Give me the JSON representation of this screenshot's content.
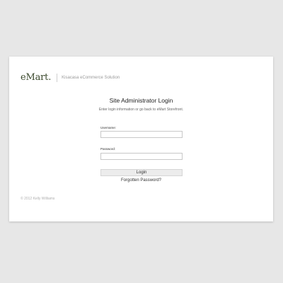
{
  "brand": {
    "logo_text": "eMart",
    "logo_dot": ".",
    "tagline": "Kisacasa eCommerce Solution"
  },
  "login": {
    "title": "Site Administrator Login",
    "subtitle": "Enter login information or go back to eMart Storefront.",
    "username_label": "Username:",
    "username_value": "",
    "password_label": "Password:",
    "password_value": "",
    "login_button": "Login",
    "forgot_link": "Forgotten Password?"
  },
  "footer": {
    "copyright": "© 2012 Kelly Williams"
  }
}
